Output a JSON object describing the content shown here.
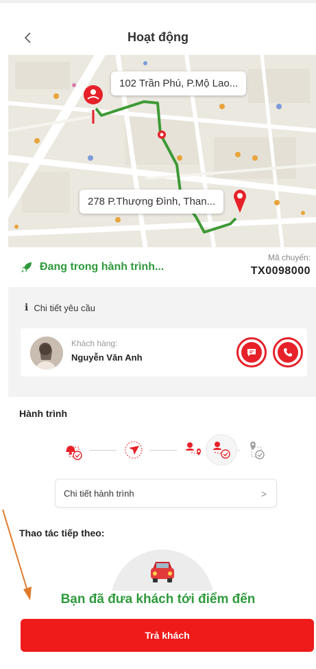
{
  "header": {
    "title": "Hoạt động"
  },
  "map": {
    "pickup_address": "102 Trần Phú, P.Mộ Lao...",
    "dropoff_address": "278 P.Thượng Đình, Than..."
  },
  "status": {
    "text": "Đang trong hành trình...",
    "trip_code_label": "Mã chuyến:",
    "trip_code": "TX0098000"
  },
  "request": {
    "title": "Chi tiết yêu cầu",
    "customer_label": "Khách hàng:",
    "customer_name": "Nguyễn Văn Anh"
  },
  "journey": {
    "title": "Hành trình",
    "detail_label": "Chi tiết hành trình",
    "active_step": 4,
    "step_count": 5
  },
  "next_action": {
    "title": "Thao tác tiếp theo:",
    "message": "Bạn đã đưa khách tới điểm đến",
    "button_label": "Trả khách"
  },
  "colors": {
    "brand_red": "#ef1b1b",
    "status_green": "#2e9a3c",
    "route_green": "#3d9a35"
  },
  "icons": {
    "back": "chevron-left-icon",
    "status": "rocket-icon",
    "info": "info-icon",
    "chat": "chat-icon",
    "phone": "phone-icon",
    "detail": "chevron-right-icon"
  }
}
